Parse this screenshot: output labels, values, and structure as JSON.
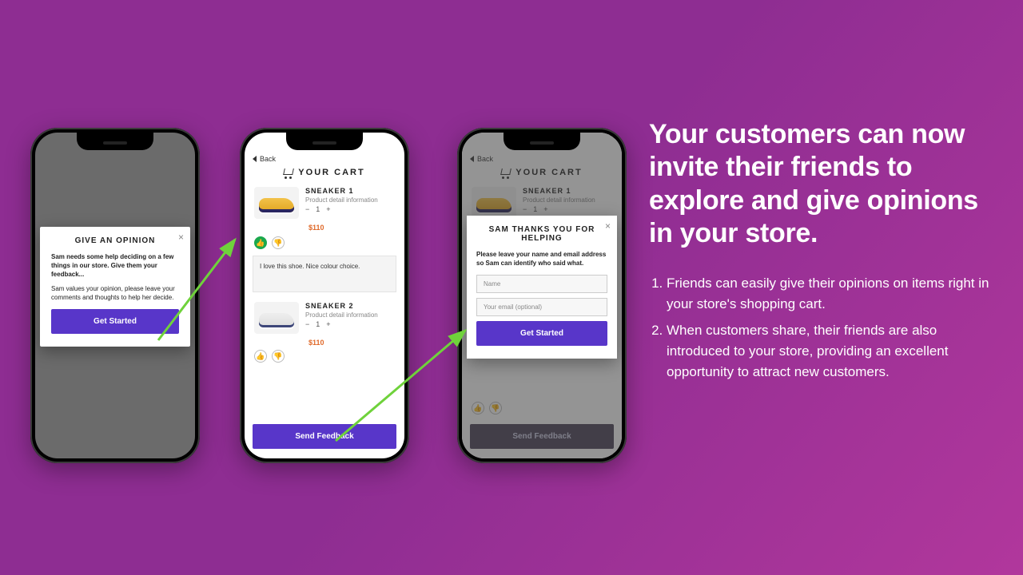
{
  "headline": "Your customers can now invite their friends to explore and give opinions in your store.",
  "bullets": [
    "Friends can easily give their opinions on items right in your store's shopping cart.",
    "When customers share, their friends are also introduced to your store, providing an excellent opportunity to attract new customers."
  ],
  "phone_common": {
    "back_label": "Back",
    "cart_title": "YOUR CART",
    "send_label": "Send Feedback"
  },
  "products": [
    {
      "name": "SNEAKER 1",
      "subtitle": "Product detail information",
      "qty": "1",
      "price": "$110"
    },
    {
      "name": "SNEAKER 2",
      "subtitle": "Product detail information",
      "qty": "1",
      "price": "$110"
    }
  ],
  "phone1": {
    "modal_title": "GIVE AN OPINION",
    "line1": "Sam needs some help deciding on a few things in our store. Give them your feedback...",
    "line2": "Sam values your opinion, please leave your comments and thoughts to help her decide.",
    "cta": "Get Started"
  },
  "phone2": {
    "comment": "I love this shoe. Nice colour choice."
  },
  "phone3": {
    "modal_title": "SAM THANKS YOU FOR HELPING",
    "line1": "Please leave your name and email address so Sam can identify who said what.",
    "name_ph": "Name",
    "email_ph": "Your email (optional)",
    "cta": "Get Started"
  }
}
